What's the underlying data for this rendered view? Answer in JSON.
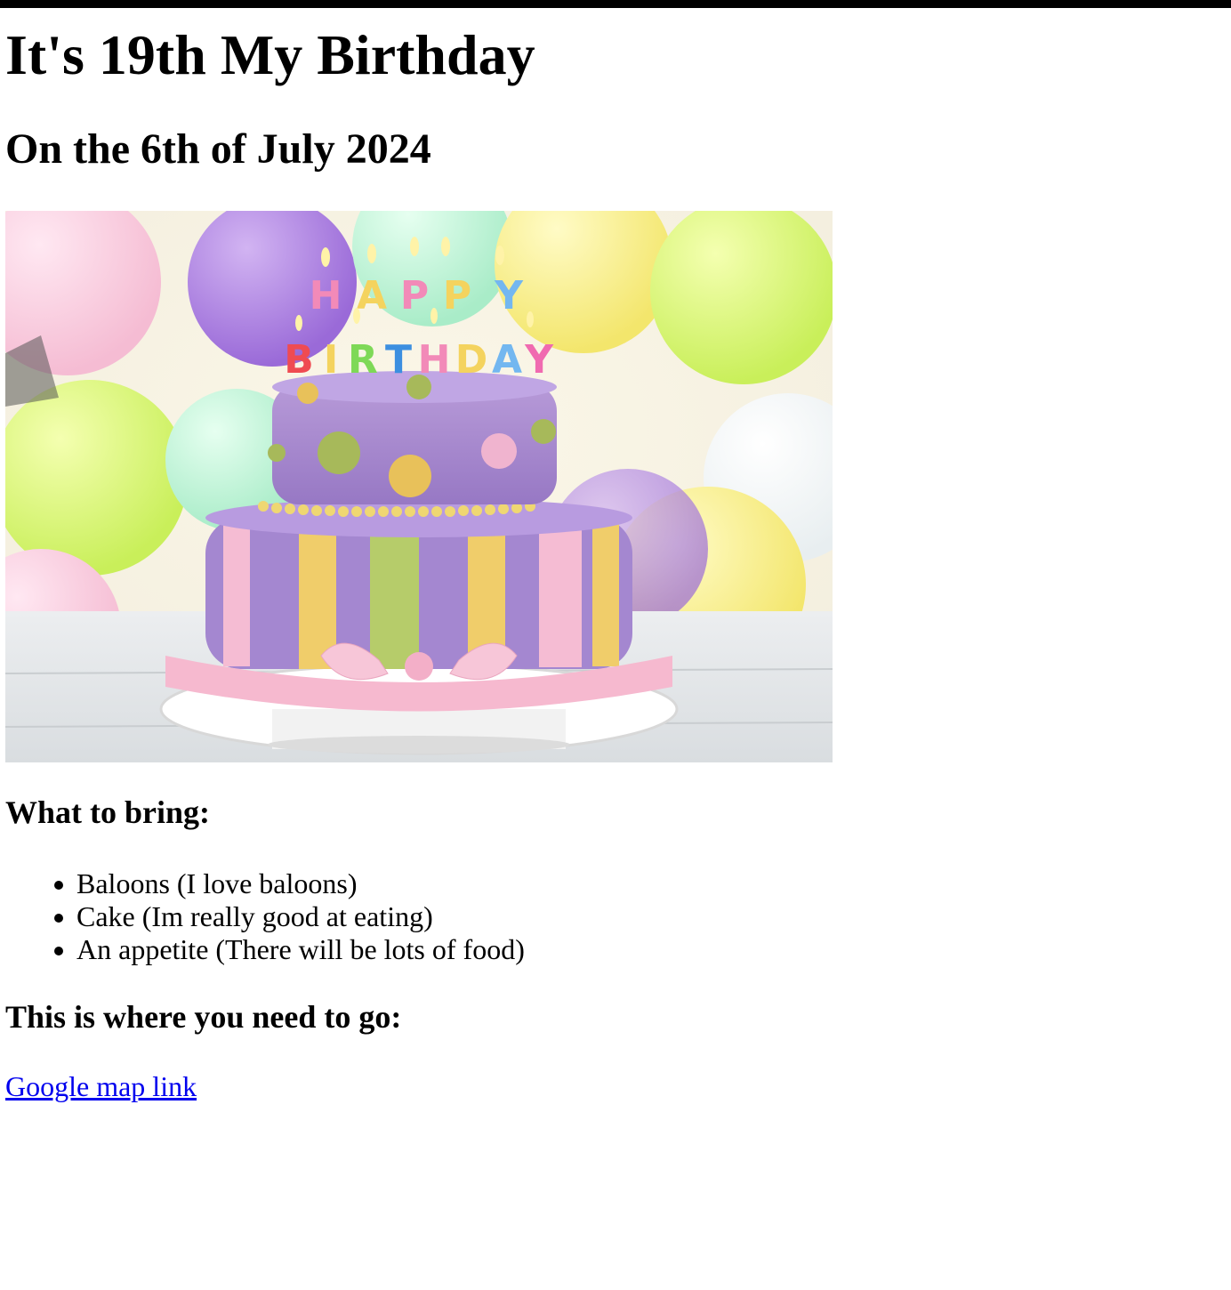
{
  "page": {
    "title": "It's 19th My Birthday",
    "subtitle": "On the 6th of July 2024"
  },
  "hero_image": {
    "icon": "birthday-cake-image",
    "candle_top_word": [
      "H",
      "A",
      "P",
      "P",
      "Y"
    ],
    "candle_bottom_word": [
      "B",
      "I",
      "R",
      "T",
      "H",
      "D",
      "A",
      "Y"
    ]
  },
  "bring": {
    "heading": "What to bring:",
    "items": [
      "Baloons (I love baloons)",
      "Cake (Im really good at eating)",
      "An appetite (There will be lots of food)"
    ]
  },
  "directions": {
    "heading": "This is where you need to go:",
    "link_text": "Google map link"
  },
  "colors": {
    "link": "#0000ee",
    "top_bar": "#000000"
  }
}
